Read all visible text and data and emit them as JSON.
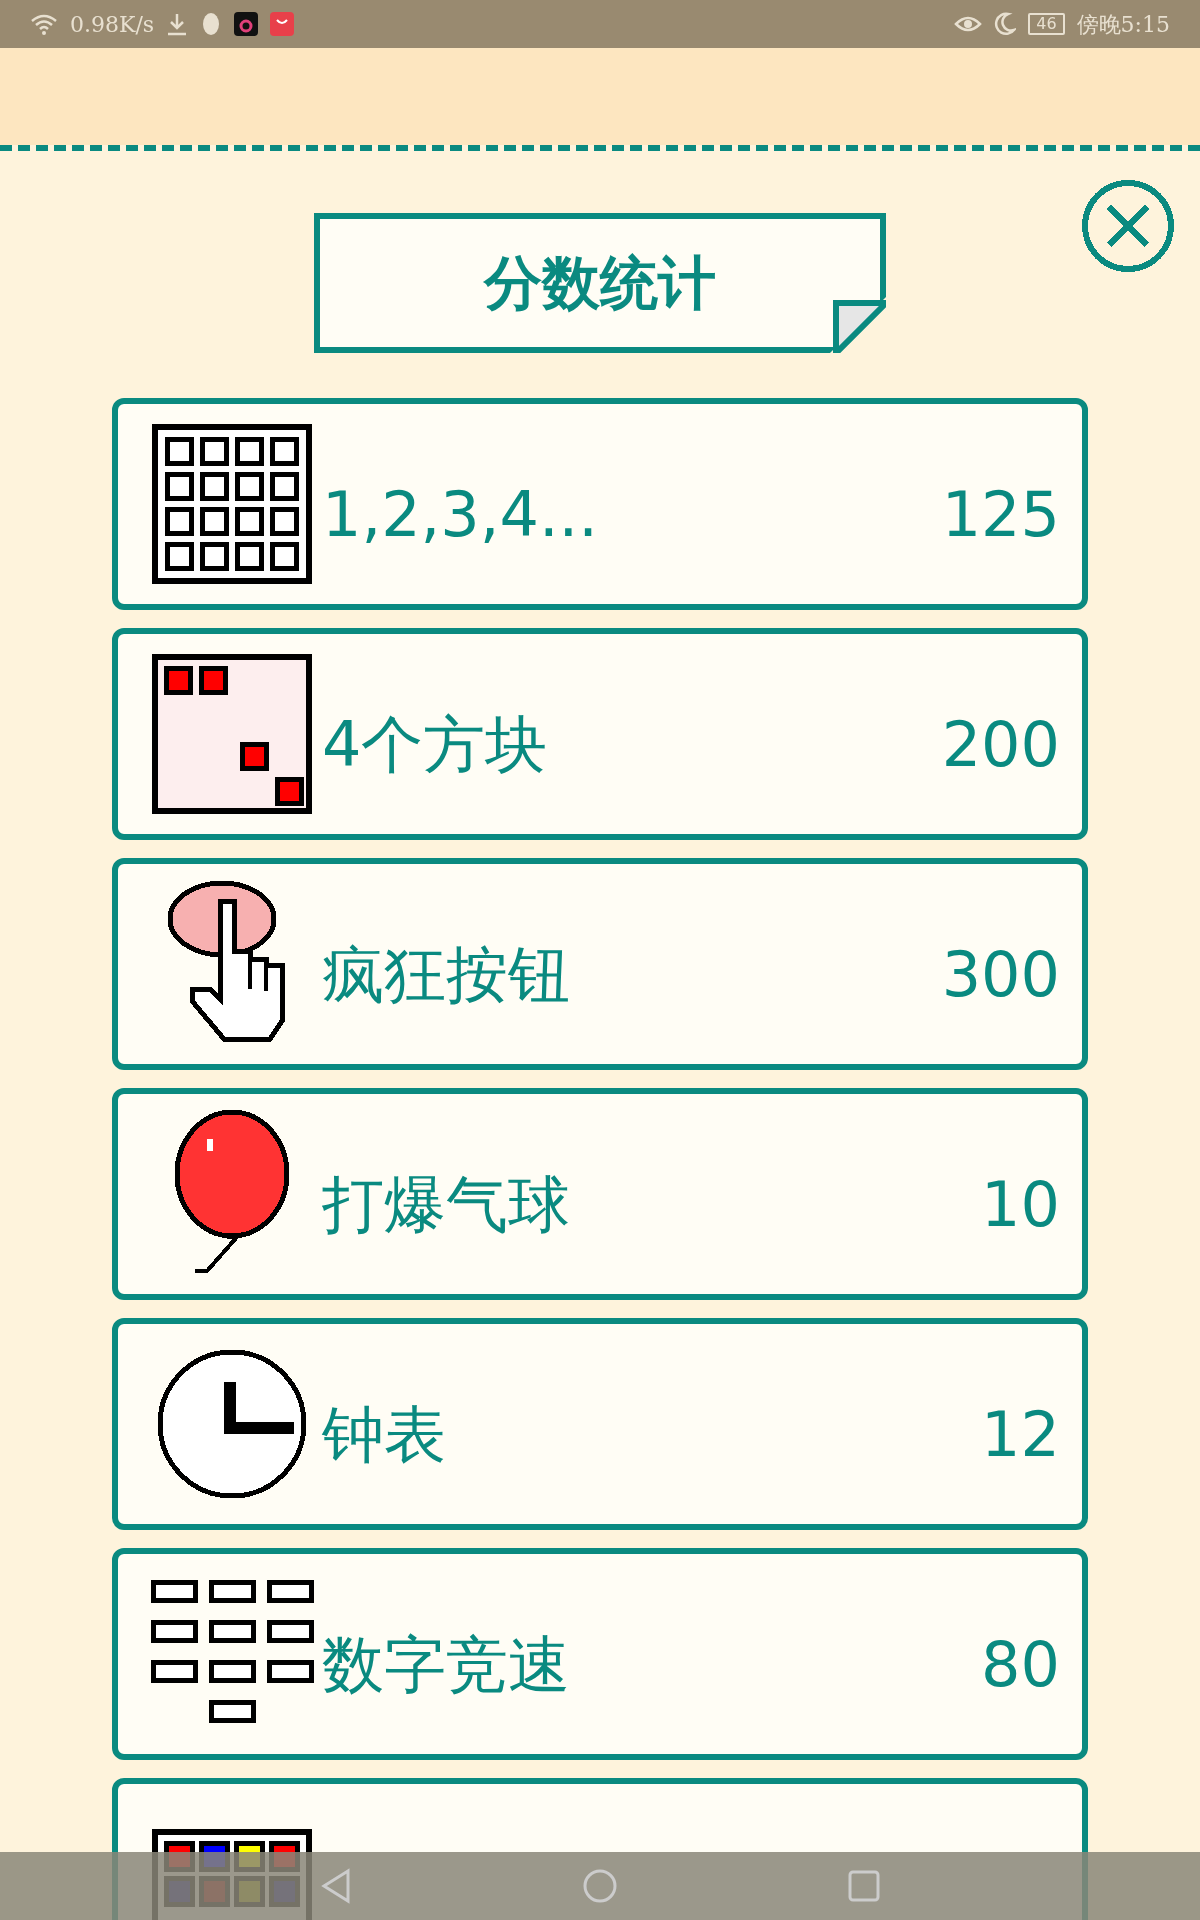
{
  "status_bar": {
    "speed": "0.98K/s",
    "battery": "46",
    "time": "傍晚5:15"
  },
  "title": "分数统计",
  "scores": [
    {
      "kind": "grid",
      "label": "1,2,3,4...",
      "value": "125"
    },
    {
      "kind": "squares",
      "label": "4个方块",
      "value": "200"
    },
    {
      "kind": "button",
      "label": "疯狂按钮",
      "value": "300"
    },
    {
      "kind": "balloon",
      "label": "打爆气球",
      "value": "10"
    },
    {
      "kind": "clock",
      "label": "钟表",
      "value": "12"
    },
    {
      "kind": "keypad",
      "label": "数字竞速",
      "value": "80"
    },
    {
      "kind": "colors"
    }
  ]
}
